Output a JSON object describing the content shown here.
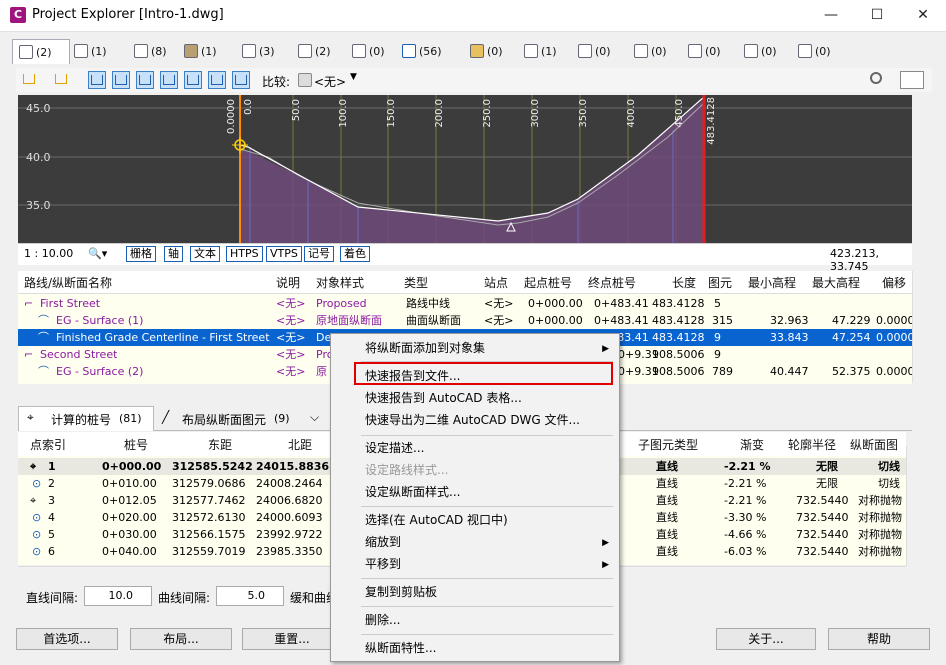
{
  "window": {
    "title": "Project Explorer [Intro-1.dwg]",
    "icon_text": "C",
    "min": "—",
    "max": "☐",
    "close": "✕"
  },
  "tabs": [
    {
      "count": "(2)"
    },
    {
      "count": "(1)"
    },
    {
      "count": "(8)"
    },
    {
      "count": "(1)"
    },
    {
      "count": "(3)"
    },
    {
      "count": "(2)"
    },
    {
      "count": "(0)"
    },
    {
      "count": "(56)"
    },
    {
      "count": "(0)"
    },
    {
      "count": "(1)"
    },
    {
      "count": "(0)"
    },
    {
      "count": "(0)"
    },
    {
      "count": "(0)"
    },
    {
      "count": "(0)"
    },
    {
      "count": "(0)"
    }
  ],
  "toolbar": {
    "compare_label": "比较:",
    "compare_value": "<无>"
  },
  "plot": {
    "y_ticks": [
      "45.0",
      "40.0",
      "35.0"
    ],
    "stations": [
      "0.0000",
      "0.0",
      "50.0",
      "100.0",
      "150.0",
      "200.0",
      "250.0",
      "300.0",
      "350.0",
      "400.0",
      "450.0",
      "483.4128"
    ],
    "coords": "423.213, 33.745",
    "scale": "1 : 10.00",
    "buttons": [
      "栅格",
      "轴",
      "文本",
      "HTPS",
      "VTPS",
      "记号",
      "着色"
    ]
  },
  "upper_table": {
    "headers": [
      "路线/纵断面名称",
      "说明",
      "对象样式",
      "类型",
      "站点",
      "起点桩号",
      "终点桩号",
      "长度",
      "图元",
      "最小高程",
      "最大高程",
      "偏移"
    ],
    "rows": [
      {
        "name": "First Street",
        "desc": "<无>",
        "style": "Proposed",
        "type": "路线中线",
        "site": "<无>",
        "start": "0+000.00",
        "end": "0+483.41",
        "length": "483.4128",
        "elems": "5",
        "min": "",
        "max": "",
        "offset": ""
      },
      {
        "name": "EG - Surface (1)",
        "desc": "<无>",
        "style": "原地面纵断面",
        "type": "曲面纵断面",
        "site": "<无>",
        "start": "0+000.00",
        "end": "0+483.41",
        "length": "483.4128",
        "elems": "315",
        "min": "32.963",
        "max": "47.229",
        "offset": "0.0000"
      },
      {
        "name": "Finished Grade Centerline - First Street",
        "desc": "<无>",
        "style": "De",
        "type": "",
        "site": "",
        "start": "",
        "end": "0+483.41",
        "length": "483.4128",
        "elems": "9",
        "min": "33.843",
        "max": "47.254",
        "offset": "0.0000"
      },
      {
        "name": "Second Street",
        "desc": "<无>",
        "style": "Pro",
        "type": "",
        "site": "",
        "start": "",
        "end": "0+9.31",
        "length": "908.5006",
        "elems": "9",
        "min": "",
        "max": "",
        "offset": ""
      },
      {
        "name": "EG - Surface (2)",
        "desc": "<无>",
        "style": "原",
        "type": "",
        "site": "",
        "start": "",
        "end": "0+9.31",
        "length": "908.5006",
        "elems": "789",
        "min": "40.447",
        "max": "52.375",
        "offset": "0.0000"
      }
    ]
  },
  "lower_tabs": [
    {
      "label": "计算的桩号",
      "count": "(81)"
    },
    {
      "label": "布局纵断面图元",
      "count": "(9)"
    }
  ],
  "lower_table": {
    "headers": [
      "点索引",
      "桩号",
      "东距",
      "北距",
      "子图元类型",
      "渐变",
      "轮廓半径",
      "纵断面图"
    ],
    "rows": [
      {
        "idx": "1",
        "station": "0+000.00",
        "east": "312585.5242",
        "north": "24015.8836",
        "subtype": "直线",
        "grade": "-2.21 %",
        "radius": "无限",
        "type": "切线"
      },
      {
        "idx": "2",
        "station": "0+010.00",
        "east": "312579.0686",
        "north": "24008.2464",
        "subtype": "直线",
        "grade": "-2.21 %",
        "radius": "无限",
        "type": "切线"
      },
      {
        "idx": "3",
        "station": "0+012.05",
        "east": "312577.7462",
        "north": "24006.6820",
        "subtype": "直线",
        "grade": "-2.21 %",
        "radius": "732.5440",
        "type": "对称抛物"
      },
      {
        "idx": "4",
        "station": "0+020.00",
        "east": "312572.6130",
        "north": "24000.6093",
        "subtype": "直线",
        "grade": "-3.30 %",
        "radius": "732.5440",
        "type": "对称抛物"
      },
      {
        "idx": "5",
        "station": "0+030.00",
        "east": "312566.1575",
        "north": "23992.9722",
        "subtype": "直线",
        "grade": "-4.66 %",
        "radius": "732.5440",
        "type": "对称抛物"
      },
      {
        "idx": "6",
        "station": "0+040.00",
        "east": "312559.7019",
        "north": "23985.3350",
        "subtype": "直线",
        "grade": "-6.03 %",
        "radius": "732.5440",
        "type": "对称抛物"
      }
    ]
  },
  "footer": {
    "line_interval_label": "直线间隔:",
    "line_interval": "10.0",
    "curve_interval_label": "曲线间隔:",
    "curve_interval": "5.0",
    "spiral_label": "缓和曲线",
    "buttons": {
      "options": "首选项...",
      "layout": "布局...",
      "reset": "重置...",
      "about": "关于...",
      "help": "帮助"
    }
  },
  "context_menu": {
    "items": [
      {
        "label": "将纵断面添加到对象集",
        "submenu": true
      },
      {
        "label": "快速报告到文件...",
        "highlighted": true
      },
      {
        "label": "快速报告到 AutoCAD 表格..."
      },
      {
        "label": "快速导出为二维 AutoCAD DWG 文件..."
      },
      {
        "label": "设定描述..."
      },
      {
        "label": "设定路线样式...",
        "disabled": true
      },
      {
        "label": "设定纵断面样式..."
      },
      {
        "label": "选择(在 AutoCAD 视口中)"
      },
      {
        "label": "缩放到",
        "submenu": true
      },
      {
        "label": "平移到",
        "submenu": true
      },
      {
        "label": "复制到剪贴板"
      },
      {
        "label": "删除..."
      },
      {
        "label": "纵断面特性..."
      }
    ]
  },
  "colors": {
    "selection": "#0a64d0",
    "highlight_box": "#e00000",
    "plot_bg": "#3c3c3c",
    "profile_fill": "#6e4a7a"
  }
}
